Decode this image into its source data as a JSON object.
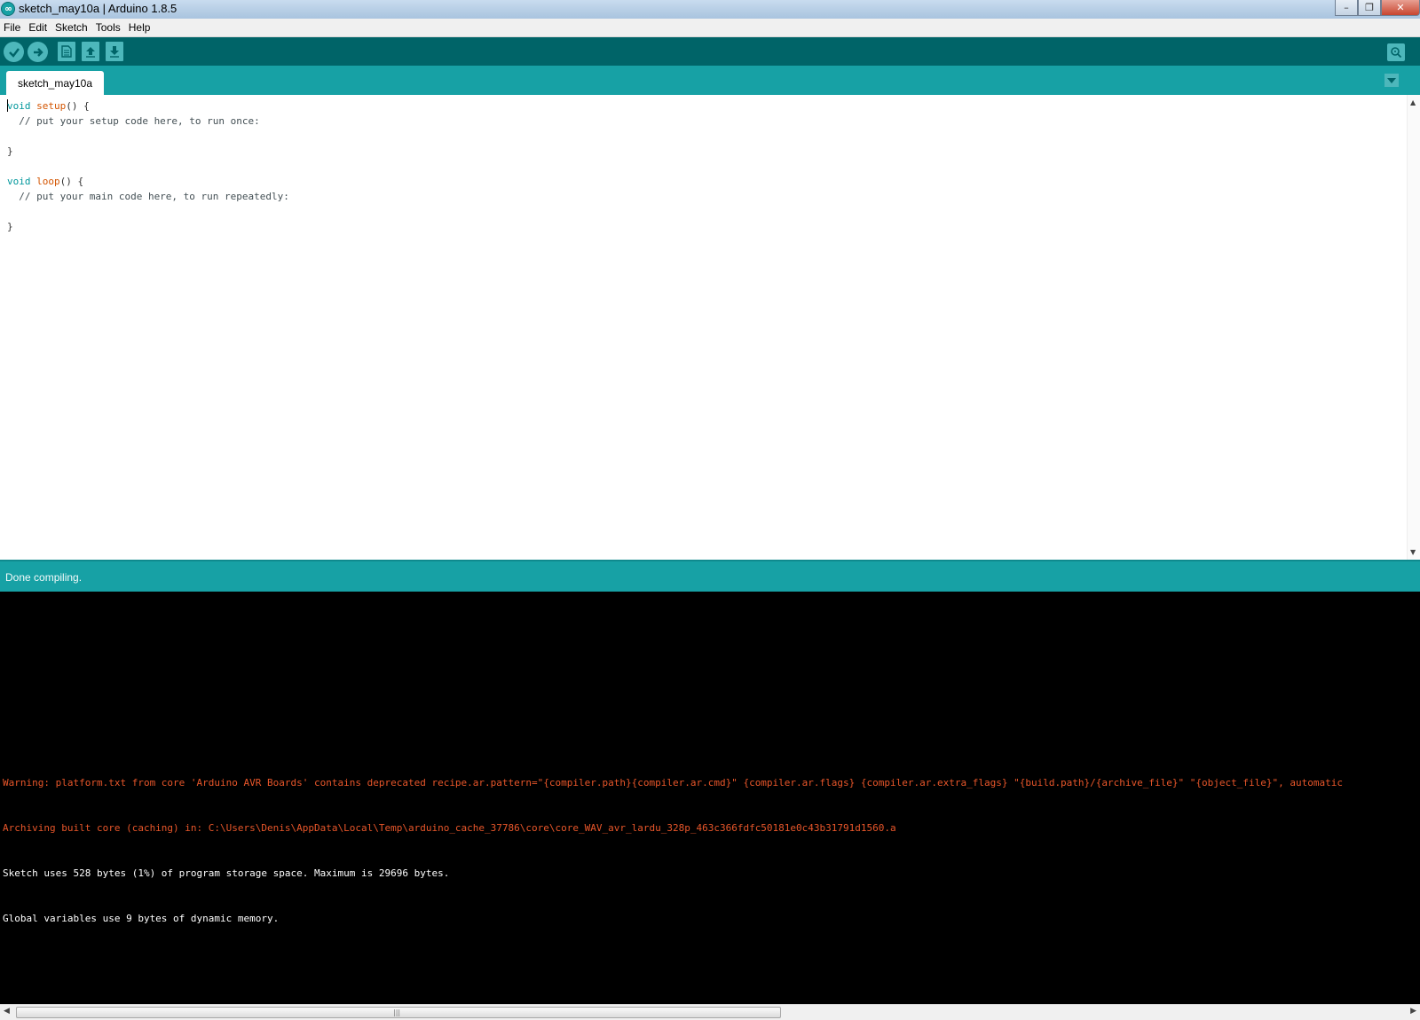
{
  "window": {
    "title": "sketch_may10a | Arduino 1.8.5",
    "logo_text": "oo",
    "controls": {
      "minimize": "–",
      "maximize": "❐",
      "close": "✕"
    }
  },
  "menu": {
    "items": [
      "File",
      "Edit",
      "Sketch",
      "Tools",
      "Help"
    ]
  },
  "toolbar": {
    "buttons": [
      "verify-icon",
      "upload-icon",
      "new-icon",
      "open-icon",
      "save-icon"
    ],
    "serial_monitor": "serial-monitor-icon"
  },
  "tabs": {
    "active": "sketch_may10a"
  },
  "editor": {
    "lines": [
      {
        "kw": "void",
        "fn": "setup",
        "rest": "() {"
      },
      {
        "cm": "  // put your setup code here, to run once:"
      },
      {
        "cm": ""
      },
      {
        "cm": "}"
      },
      {
        "cm": ""
      },
      {
        "kw": "void",
        "fn": "loop",
        "rest": "() {"
      },
      {
        "cm": "  // put your main code here, to run repeatedly:"
      },
      {
        "cm": ""
      },
      {
        "cm": "}"
      }
    ]
  },
  "status": {
    "text": "Done compiling."
  },
  "console": {
    "lines": [
      {
        "type": "warn",
        "text": "Warning: platform.txt from core 'Arduino AVR Boards' contains deprecated recipe.ar.pattern=\"{compiler.path}{compiler.ar.cmd}\" {compiler.ar.flags} {compiler.ar.extra_flags} \"{build.path}/{archive_file}\" \"{object_file}\", automatic"
      },
      {
        "type": "warn",
        "text": "Archiving built core (caching) in: C:\\Users\\Denis\\AppData\\Local\\Temp\\arduino_cache_37786\\core\\core_WAV_avr_lardu_328p_463c366fdfc50181e0c43b31791d1560.a"
      },
      {
        "type": "info",
        "text": "Sketch uses 528 bytes (1%) of program storage space. Maximum is 29696 bytes."
      },
      {
        "type": "info",
        "text": "Global variables use 9 bytes of dynamic memory."
      }
    ]
  },
  "colors": {
    "toolbar": "#006468",
    "tabbar": "#17a1a5",
    "button": "#4db7bb",
    "warning_text": "#e8562a",
    "keyword": "#00979c",
    "function": "#d35400"
  }
}
